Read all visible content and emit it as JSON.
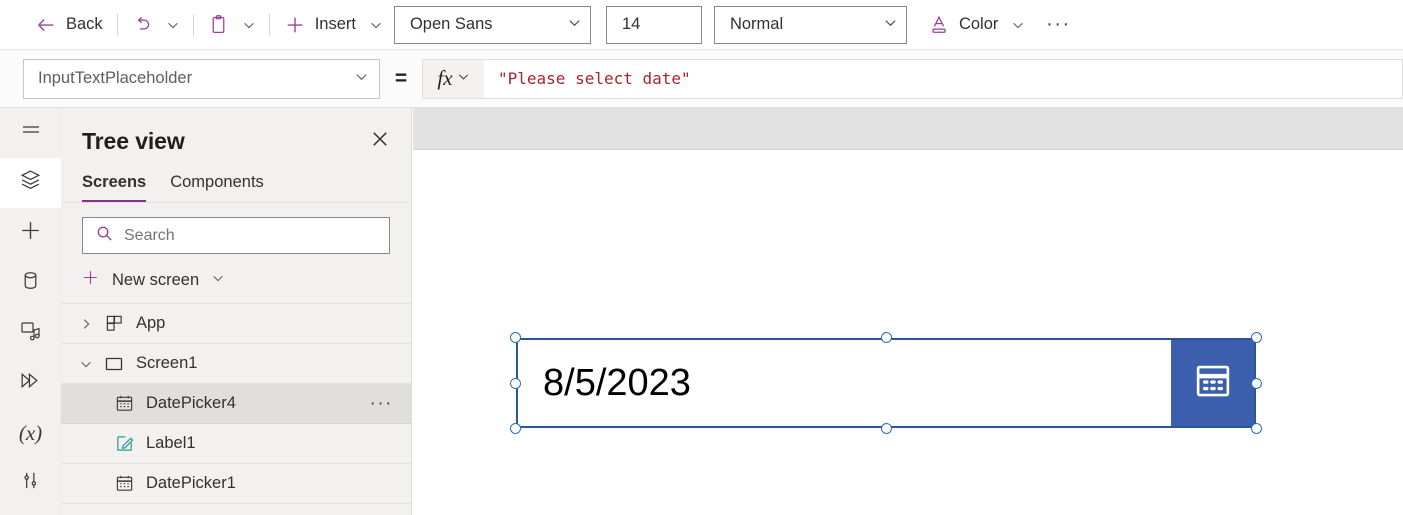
{
  "toolbar": {
    "back_label": "Back",
    "undo_icon": "undo-icon",
    "undo_chevron_icon": "chevron-down-icon",
    "paste_icon": "clipboard-paste-icon",
    "paste_chevron_icon": "chevron-down-icon",
    "insert_icon": "plus-icon",
    "insert_label": "Insert",
    "insert_chevron_icon": "chevron-down-icon",
    "font_name": "Open Sans",
    "font_size": "14",
    "font_weight": "Normal",
    "color_icon": "font-color-icon",
    "color_label": "Color",
    "color_chevron_icon": "chevron-down-icon",
    "overflow_label": "···"
  },
  "formula_bar": {
    "property": "InputTextPlaceholder",
    "property_chevron_icon": "chevron-down-icon",
    "equals": "=",
    "fx_label": "fx",
    "fx_chevron_icon": "chevron-down-icon",
    "formula": "\"Please select date\""
  },
  "rail": {
    "items": [
      {
        "name": "hamburger-menu-icon",
        "active": false
      },
      {
        "name": "tree-view-layers-icon",
        "active": true
      },
      {
        "name": "insert-plus-icon",
        "active": false
      },
      {
        "name": "data-cylinder-icon",
        "active": false
      },
      {
        "name": "media-icon",
        "active": false
      },
      {
        "name": "power-automate-flow-icon",
        "active": false
      },
      {
        "name": "variables-x-icon",
        "active": false
      },
      {
        "name": "settings-tools-icon",
        "active": false
      }
    ]
  },
  "tree_view": {
    "title": "Tree view",
    "close_icon": "close-icon",
    "tabs": [
      {
        "label": "Screens",
        "active": true
      },
      {
        "label": "Components",
        "active": false
      }
    ],
    "search": {
      "placeholder": "Search",
      "value": "",
      "icon": "search-icon"
    },
    "new_screen": {
      "label": "New screen",
      "icon": "plus-icon",
      "chevron_icon": "chevron-down-icon"
    },
    "items": [
      {
        "label": "App",
        "icon": "app-grid-icon",
        "twisty": "chevron-right-icon",
        "depth": 0,
        "selected": false,
        "more": false
      },
      {
        "label": "Screen1",
        "icon": "screen-rectangle-icon",
        "twisty": "chevron-down-icon",
        "depth": 0,
        "selected": false,
        "more": false
      },
      {
        "label": "DatePicker4",
        "icon": "calendar-icon",
        "twisty": "",
        "depth": 1,
        "selected": true,
        "more": true
      },
      {
        "label": "Label1",
        "icon": "label-pencil-icon",
        "twisty": "",
        "depth": 1,
        "selected": false,
        "more": false
      },
      {
        "label": "DatePicker1",
        "icon": "calendar-icon",
        "twisty": "",
        "depth": 1,
        "selected": false,
        "more": false
      }
    ]
  },
  "canvas": {
    "date_picker": {
      "value": "8/5/2023",
      "button_icon": "calendar-icon",
      "selected": true
    }
  },
  "colors": {
    "accent_purple": "#8b2f8e",
    "formula_red": "#a4262c",
    "selection_blue": "#2b579a",
    "datepicker_button_blue": "#3b5fad",
    "panel_bg": "#f2f1f0",
    "selected_row": "#e0dfde"
  }
}
